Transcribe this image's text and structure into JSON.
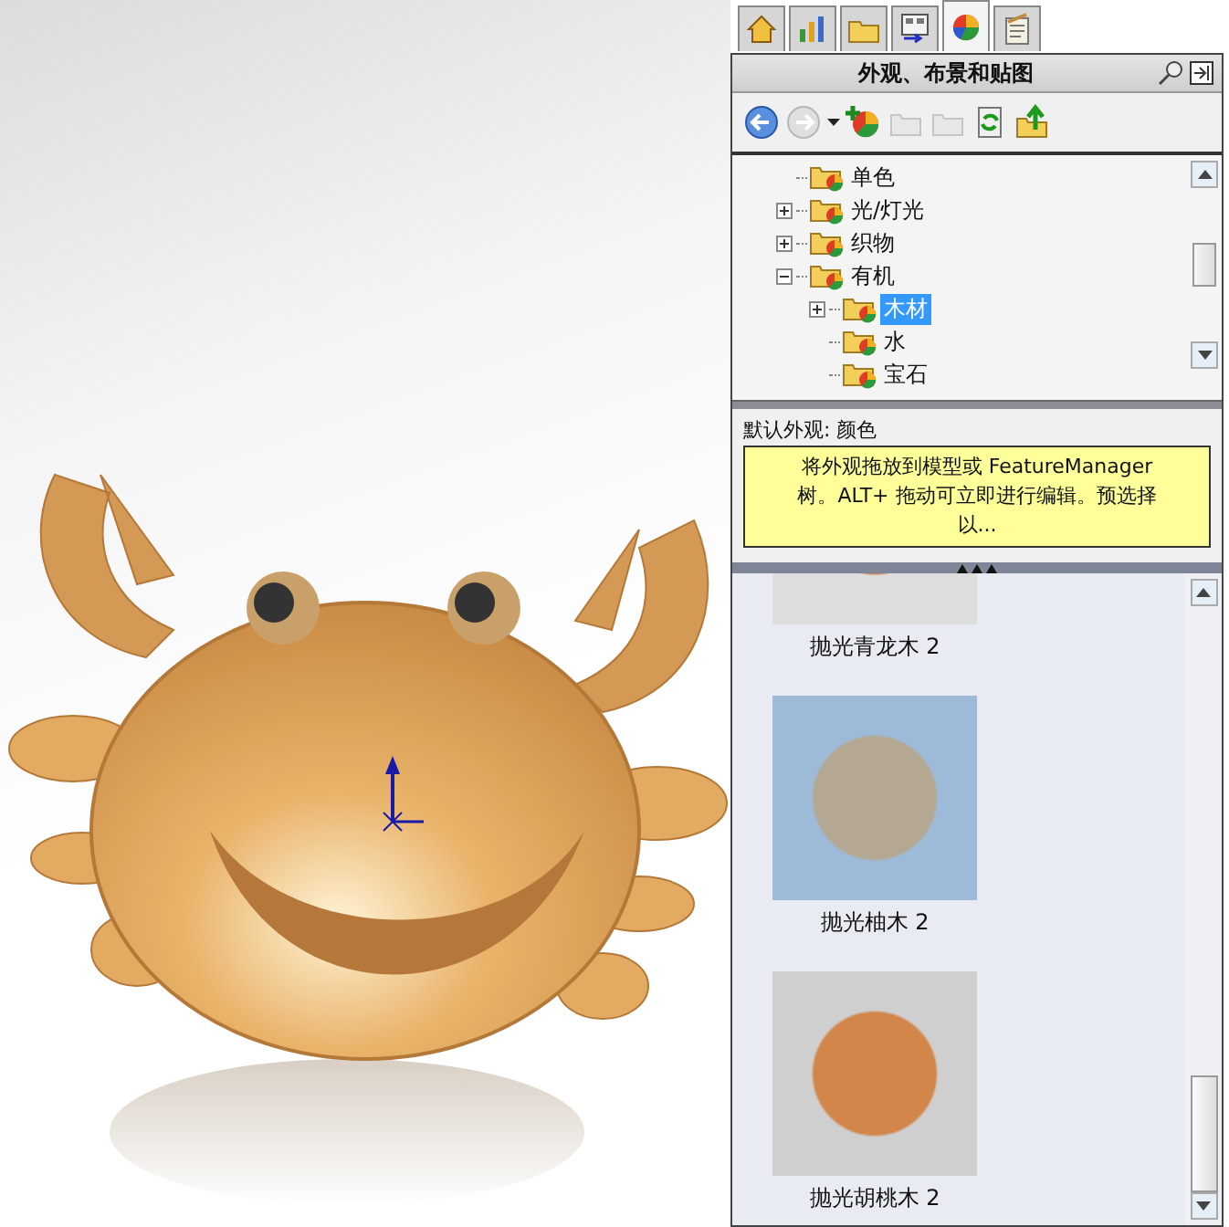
{
  "tabs": [
    {
      "selected": false
    },
    {
      "selected": false
    },
    {
      "selected": false
    },
    {
      "selected": false
    },
    {
      "selected": true
    },
    {
      "selected": false
    }
  ],
  "panel": {
    "title": "外观、布景和贴图",
    "toolbar": [
      {
        "disabled": false
      },
      {
        "disabled": true
      },
      {
        "disabled": false
      },
      {
        "disabled": false
      },
      {
        "disabled": true
      },
      {
        "disabled": true
      },
      {
        "disabled": false
      },
      {
        "disabled": false
      }
    ],
    "tree": [
      {
        "label": "单色",
        "selected": false
      },
      {
        "label": "光/灯光",
        "selected": false,
        "expanded": false
      },
      {
        "label": "织物",
        "selected": false,
        "expanded": false
      },
      {
        "label": "有机",
        "selected": false,
        "expanded": true,
        "children": [
          {
            "label": "木材",
            "selected": true,
            "expanded": false
          },
          {
            "label": "水",
            "selected": false
          },
          {
            "label": "宝石",
            "selected": false
          }
        ]
      }
    ],
    "default_label": "默认外观: 颜色",
    "tooltip": "将外观拖放到模型或 FeatureManager 树。ALT+ 拖动可立即进行编辑。预选择以...",
    "gallery": [
      {
        "caption": "抛光青龙木 2"
      },
      {
        "caption": "抛光柚木 2"
      },
      {
        "caption": "抛光胡桃木 2"
      }
    ]
  }
}
